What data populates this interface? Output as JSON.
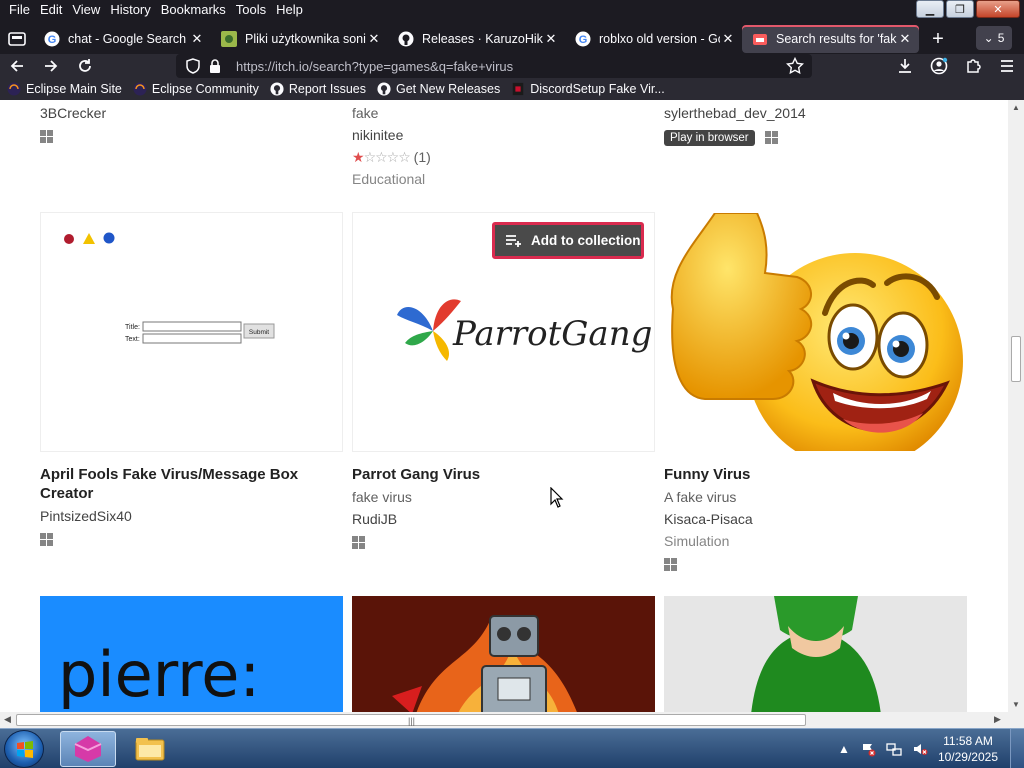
{
  "menubar": {
    "items": [
      {
        "label": "File"
      },
      {
        "label": "Edit"
      },
      {
        "label": "View"
      },
      {
        "label": "History"
      },
      {
        "label": "Bookmarks"
      },
      {
        "label": "Tools"
      },
      {
        "label": "Help"
      }
    ],
    "window_controls": {
      "minimize": "▁",
      "restore": "❐",
      "close": "✕"
    }
  },
  "tabs": [
    {
      "label": "chat - Google Search",
      "icon": "google-icon",
      "active": false
    },
    {
      "label": "Pliki użytkownika sonic",
      "icon": "image-icon",
      "active": false
    },
    {
      "label": "Releases · KaruzoHikari",
      "icon": "github-icon",
      "active": false
    },
    {
      "label": "roblxo old version - Go",
      "icon": "google-icon",
      "active": false
    },
    {
      "label": "Search results for 'fake",
      "icon": "itchio-icon",
      "active": true
    }
  ],
  "tab_controls": {
    "new_tab": "+",
    "all_tabs_count": "5"
  },
  "navigation": {
    "url": "https://itch.io/search?type=games&q=fake+virus"
  },
  "bookmarks": [
    {
      "label": "Eclipse Main Site",
      "icon": "eclipse-icon"
    },
    {
      "label": "Eclipse Community",
      "icon": "eclipse-icon"
    },
    {
      "label": "Report Issues",
      "icon": "github-icon"
    },
    {
      "label": "Get New Releases",
      "icon": "github-icon"
    },
    {
      "label": "DiscordSetup Fake Vir...",
      "icon": "itchio-icon"
    }
  ],
  "results_row_top": [
    {
      "author": "3BCrecker",
      "platform": "windows"
    },
    {
      "description": "fake",
      "author": "nikinitee",
      "rating_stars": 1,
      "rating_count": "(1)",
      "genre": "Educational"
    },
    {
      "author": "sylerthebad_dev_2014",
      "badge": "Play in browser",
      "platform": "windows"
    }
  ],
  "results_row_middle": [
    {
      "title": "April Fools Fake Virus/Message Box Creator",
      "author": "PintsizedSix40",
      "platform": "windows",
      "thumb": {
        "title_label": "Title:",
        "text_label": "Text:",
        "submit_label": "Submit"
      }
    },
    {
      "title": "Parrot Gang Virus",
      "description": "fake virus",
      "author": "RudiJB",
      "platform": "windows",
      "thumb": {
        "logo_text": "ParrotGang"
      }
    },
    {
      "title": "Funny Virus",
      "description": "A fake virus",
      "author": "Kisaca-Pisaca",
      "genre": "Simulation",
      "platform": "windows"
    }
  ],
  "results_row_bottom": [
    {
      "thumb_text": "pierre:",
      "bg": "#1a8cff"
    },
    {
      "bg": "#8a1f0f"
    },
    {
      "bg": "#e8e8e8"
    }
  ],
  "add_to_collection": {
    "label": "Add to collection"
  },
  "taskbar": {
    "clock_time": "11:58 AM",
    "clock_date": "10/29/2025",
    "tray_arrow": "▲"
  },
  "colors": {
    "accent": "#da2b4f",
    "tab_indicator": "#e2586b"
  }
}
